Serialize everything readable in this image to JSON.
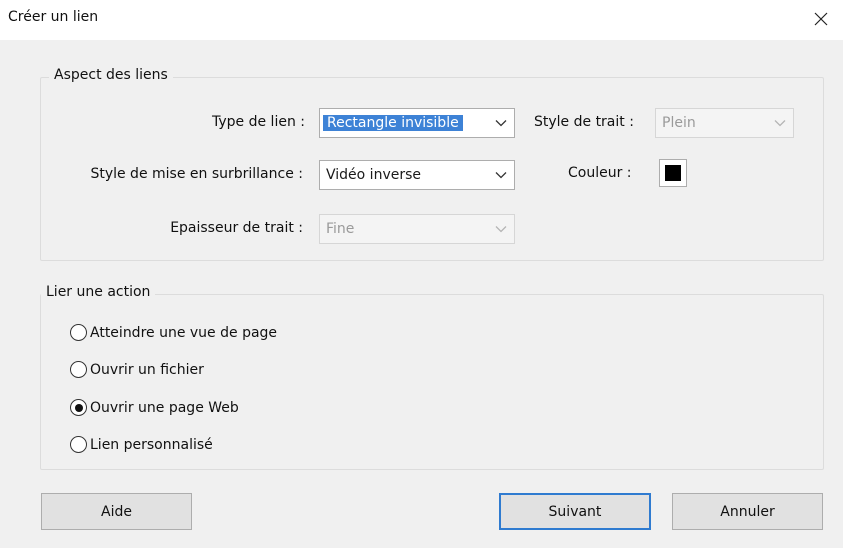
{
  "window": {
    "title": "Créer un lien"
  },
  "appearance": {
    "legend": "Aspect des liens",
    "link_type": {
      "label": "Type de lien :",
      "value": "Rectangle invisible"
    },
    "highlight_style": {
      "label": "Style de mise en surbrillance :",
      "value": "Vidéo inverse"
    },
    "line_thickness": {
      "label": "Epaisseur de trait :",
      "value": "Fine"
    },
    "line_style": {
      "label": "Style de trait :",
      "value": "Plein"
    },
    "color": {
      "label": "Couleur :",
      "value": "#000000"
    }
  },
  "action": {
    "legend": "Lier une action",
    "options": [
      {
        "label": "Atteindre une vue de page",
        "selected": false
      },
      {
        "label": "Ouvrir un fichier",
        "selected": false
      },
      {
        "label": "Ouvrir une page Web",
        "selected": true
      },
      {
        "label": "Lien personnalisé",
        "selected": false
      }
    ]
  },
  "buttons": {
    "help": "Aide",
    "next": "Suivant",
    "cancel": "Annuler"
  },
  "colors": {
    "accent": "#2f7bd0",
    "selection": "#3d82d6"
  }
}
